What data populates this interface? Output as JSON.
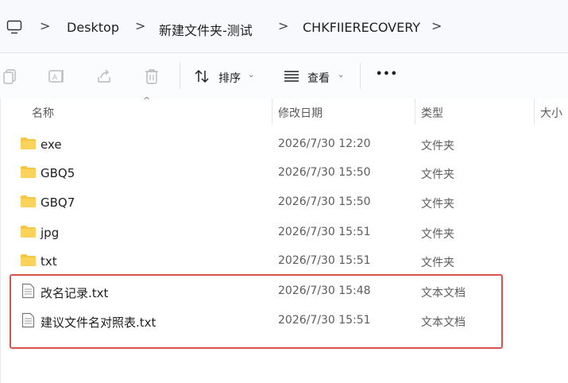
{
  "breadcrumb": {
    "items": [
      "Desktop",
      "新建文件夹-测试",
      "CHKFIIERECOVERY"
    ],
    "separator": ">"
  },
  "toolbar": {
    "sort_label": "排序",
    "view_label": "查看",
    "more_label": "•••"
  },
  "columns": {
    "name": "名称",
    "date": "修改日期",
    "type": "类型",
    "size": "大小"
  },
  "files": [
    {
      "icon": "folder-icon",
      "name": "exe",
      "date": "2026/7/30 12:20",
      "type": "文件夹"
    },
    {
      "icon": "folder-icon",
      "name": "GBQ5",
      "date": "2026/7/30 15:50",
      "type": "文件夹"
    },
    {
      "icon": "folder-icon",
      "name": "GBQ7",
      "date": "2026/7/30 15:50",
      "type": "文件夹"
    },
    {
      "icon": "folder-icon",
      "name": "jpg",
      "date": "2026/7/30 15:51",
      "type": "文件夹"
    },
    {
      "icon": "folder-icon",
      "name": "txt",
      "date": "2026/7/30 15:51",
      "type": "文件夹"
    },
    {
      "icon": "text-file-icon",
      "name": "改名记录.txt",
      "date": "2026/7/30 15:48",
      "type": "文本文档"
    },
    {
      "icon": "text-file-icon",
      "name": "建议文件名对照表.txt",
      "date": "2026/7/30 15:51",
      "type": "文本文档"
    }
  ],
  "colors": {
    "folder": "#f7c642",
    "highlight": "#d9534f"
  }
}
